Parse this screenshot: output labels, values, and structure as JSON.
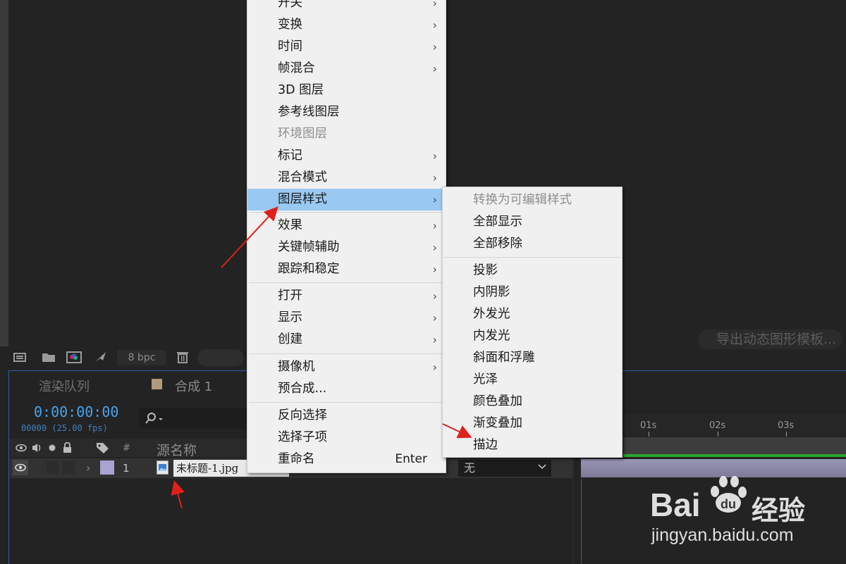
{
  "export_button": "导出动态图形模板...",
  "project_toolbar": {
    "bpc": "8 bpc"
  },
  "timeline": {
    "tabs": [
      "渲染队列",
      "合成 1"
    ],
    "timecode": "0:00:00:00",
    "fps": "00000 (25.00 fps)",
    "columns": {
      "num": "#",
      "source": "源名称"
    },
    "layer": {
      "number": "1",
      "name": "未标题-1.jpg",
      "parent": "无"
    },
    "ruler_ticks": [
      "01s",
      "02s",
      "03s"
    ]
  },
  "context_menu": {
    "items": [
      {
        "label": "开关",
        "submenu": true
      },
      {
        "label": "变换",
        "submenu": true
      },
      {
        "label": "时间",
        "submenu": true
      },
      {
        "label": "帧混合",
        "submenu": true
      },
      {
        "label": "3D 图层"
      },
      {
        "label": "参考线图层"
      },
      {
        "label": "环境图层",
        "disabled": true
      },
      {
        "label": "标记",
        "submenu": true
      },
      {
        "label": "混合模式",
        "submenu": true
      },
      {
        "label": "图层样式",
        "submenu": true,
        "highlighted": true
      },
      {
        "label": "效果",
        "submenu": true
      },
      {
        "label": "关键帧辅助",
        "submenu": true
      },
      {
        "label": "跟踪和稳定",
        "submenu": true
      },
      {
        "label": "打开",
        "submenu": true
      },
      {
        "label": "显示",
        "submenu": true
      },
      {
        "label": "创建",
        "submenu": true
      },
      {
        "label": "摄像机",
        "submenu": true
      },
      {
        "label": "预合成..."
      },
      {
        "label": "反向选择"
      },
      {
        "label": "选择子项"
      },
      {
        "label": "重命名",
        "shortcut": "Enter"
      }
    ]
  },
  "layer_style_submenu": {
    "items": [
      {
        "label": "转换为可编辑样式",
        "disabled": true
      },
      {
        "label": "全部显示"
      },
      {
        "label": "全部移除"
      },
      {
        "label": "投影"
      },
      {
        "label": "内阴影"
      },
      {
        "label": "外发光"
      },
      {
        "label": "内发光"
      },
      {
        "label": "斜面和浮雕"
      },
      {
        "label": "光泽"
      },
      {
        "label": "颜色叠加"
      },
      {
        "label": "渐变叠加"
      },
      {
        "label": "描边"
      }
    ]
  },
  "watermark": {
    "brand": "Bai",
    "brand_cn": "经验",
    "url": "jingyan.baidu.com"
  },
  "colors": {
    "accent": "#4aa3ec",
    "highlight": "#99c9f2",
    "menu_bg": "#f0f0f0",
    "arrow": "#e0201c"
  }
}
